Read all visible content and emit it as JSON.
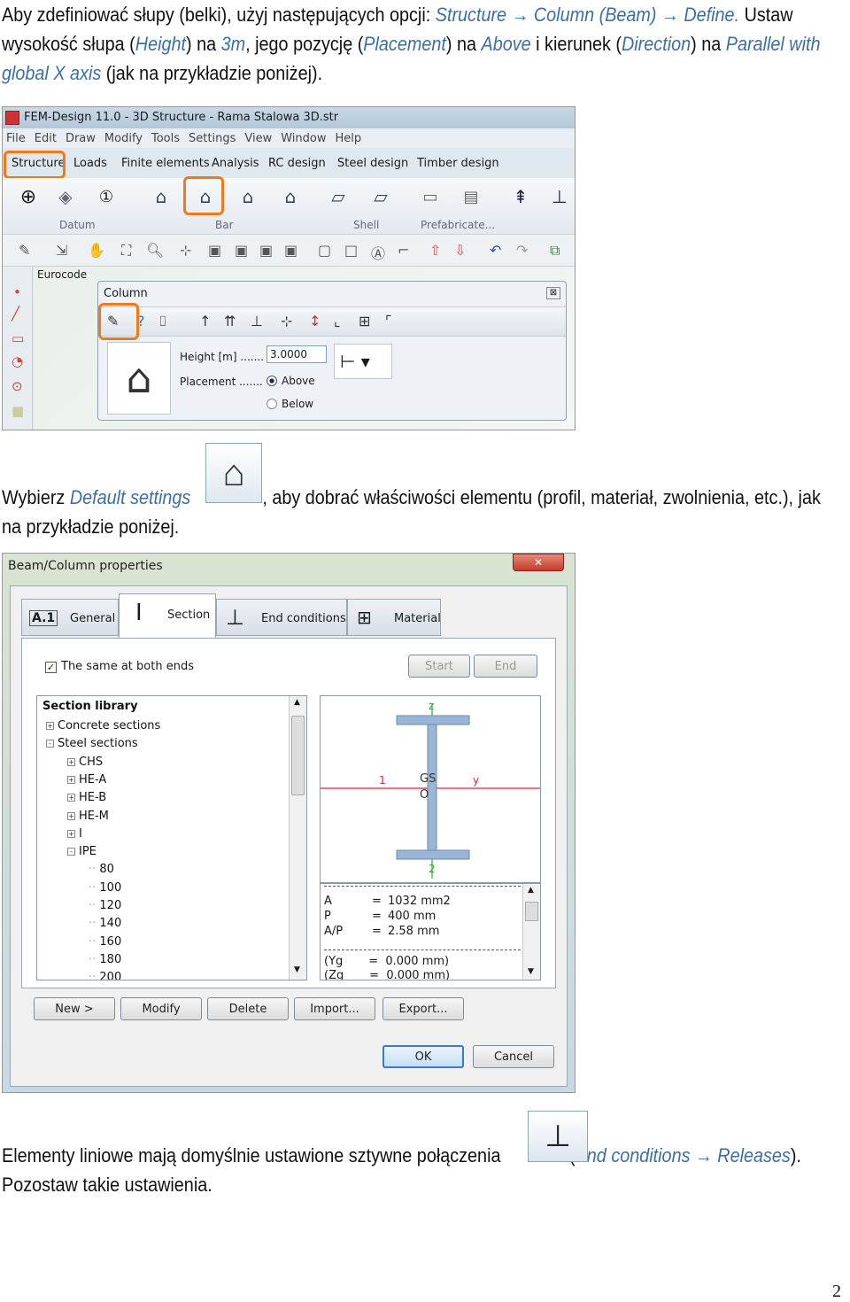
{
  "para1": {
    "t1": "Aby zdefiniować słupy (belki), użyj następujących opcji: ",
    "i1": "Structure → Column (Beam) → Define.",
    "t2": " Ustaw wysokość słupa (",
    "i2": "Height",
    "t3": ") na ",
    "i3": "3m",
    "t4": ", jego pozycję (",
    "i4": "Placement",
    "t5": ") na ",
    "i5": "Above",
    "t6": " i kierunek (",
    "i6": "Direction",
    "t7": ") na ",
    "i7": "Parallel with global X axis",
    "t8": " (jak na przykładzie poniżej)."
  },
  "para2": {
    "t1": "Wybierz ",
    "i1": "Default settings",
    "t2": ", aby dobrać właściwości elementu (profil, materiał, zwolnienia, etc.), jak",
    "t3": "na przykładzie poniżej."
  },
  "para3": {
    "t1": "Elementy liniowe mają domyślnie ustawione sztywne połączenia",
    "t2": " (",
    "i1": "End conditions → Releases",
    "t3": ").",
    "t4": "Pozostaw takie ustawienia."
  },
  "page_number": "2",
  "fem": {
    "title": "FEM-Design 11.0 - 3D Structure - Rama Stalowa 3D.str",
    "menu": [
      "File",
      "Edit",
      "Draw",
      "Modify",
      "Tools",
      "Settings",
      "View",
      "Window",
      "Help"
    ],
    "tabs": [
      "Structure",
      "Loads",
      "Finite elements",
      "Analysis",
      "RC design",
      "Steel design",
      "Timber design"
    ],
    "groups": [
      "Datum",
      "Bar",
      "Shell",
      "Prefabricate..."
    ],
    "eurocode": "Eurocode",
    "column_panel": {
      "title": "Column",
      "height_label": "Height [m] .......",
      "height_value": "3.0000",
      "placement_label": "Placement .......",
      "above": "Above",
      "below": "Below"
    }
  },
  "props": {
    "title": "Beam/Column properties",
    "tabs": [
      "General",
      "Section",
      "End conditions",
      "Material"
    ],
    "general_icon": "A.1",
    "same_both_ends": "The same at both ends",
    "start": "Start",
    "end": "End",
    "library_title": "Section library",
    "tree": [
      {
        "label": "Concrete sections",
        "level": 0,
        "sign": "+"
      },
      {
        "label": "Steel sections",
        "level": 0,
        "sign": "-"
      },
      {
        "label": "CHS",
        "level": 1,
        "sign": "+"
      },
      {
        "label": "HE-A",
        "level": 1,
        "sign": "+"
      },
      {
        "label": "HE-B",
        "level": 1,
        "sign": "+"
      },
      {
        "label": "HE-M",
        "level": 1,
        "sign": "+"
      },
      {
        "label": "I",
        "level": 1,
        "sign": "+"
      },
      {
        "label": "IPE",
        "level": 1,
        "sign": "-"
      },
      {
        "label": "80",
        "level": 2,
        "sign": ""
      },
      {
        "label": "100",
        "level": 2,
        "sign": ""
      },
      {
        "label": "120",
        "level": 2,
        "sign": ""
      },
      {
        "label": "140",
        "level": 2,
        "sign": ""
      },
      {
        "label": "160",
        "level": 2,
        "sign": ""
      },
      {
        "label": "180",
        "level": 2,
        "sign": ""
      },
      {
        "label": "200",
        "level": 2,
        "sign": ""
      }
    ],
    "axis_z": "z",
    "axis_y": "y",
    "axis_1": "1",
    "axis_2": "2",
    "gs": "GS",
    "o": "O",
    "props_text": [
      {
        "k": "A",
        "v": "1032 mm2"
      },
      {
        "k": "P",
        "v": "400 mm"
      },
      {
        "k": "A/P",
        "v": "2.58 mm"
      }
    ],
    "yg": "(Yg       =  0.000 mm)",
    "zg": "(Zg       =  0.000 mm)",
    "buttons": [
      "New >",
      "Modify",
      "Delete",
      "Import...",
      "Export..."
    ],
    "ok": "OK",
    "cancel": "Cancel",
    "close": "✕"
  }
}
